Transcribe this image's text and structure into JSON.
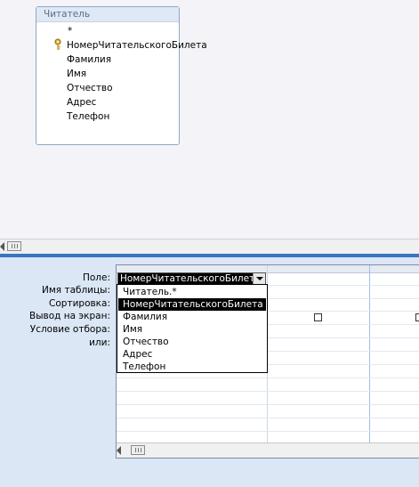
{
  "table_box": {
    "title": "Читатель",
    "fields": [
      "*",
      "НомерЧитательскогоБилета",
      "Фамилия",
      "Имя",
      "Отчество",
      "Адрес",
      "Телефон"
    ],
    "key_field_index": 1
  },
  "grid": {
    "row_labels": [
      "Поле:",
      "Имя таблицы:",
      "Сортировка:",
      "Вывод на экран:",
      "Условие отбора:",
      "или:"
    ],
    "field_combo": {
      "value": "НомерЧитательскогоБилета"
    },
    "dropdown_options": [
      "Читатель.*",
      "НомерЧитательскогоБилета",
      "Фамилия",
      "Имя",
      "Отчество",
      "Адрес",
      "Телефон"
    ],
    "selected_option_index": 1,
    "show_checkboxes": [
      false,
      false
    ]
  },
  "icons": {
    "key": "key-icon",
    "dropdown": "chevron-down-icon"
  }
}
